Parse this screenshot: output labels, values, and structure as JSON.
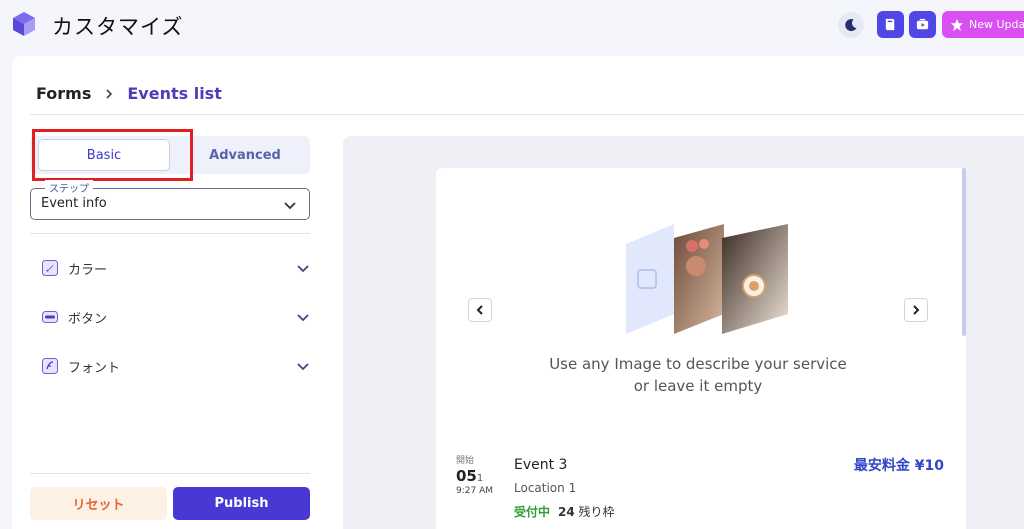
{
  "app": {
    "title": "カスタマイズ",
    "new_update_label": "New Update"
  },
  "breadcrumb": {
    "items": [
      "Forms",
      "Events list"
    ]
  },
  "tabs": {
    "basic": "Basic",
    "advanced": "Advanced"
  },
  "step_select": {
    "legend": "ステップ",
    "value": "Event info"
  },
  "accordion": [
    {
      "label": "カラー",
      "icon": "rocket-icon"
    },
    {
      "label": "ボタン",
      "icon": "button-icon"
    },
    {
      "label": "フォント",
      "icon": "font-icon"
    }
  ],
  "actions": {
    "reset": "リセット",
    "publish": "Publish"
  },
  "preview": {
    "hero_text_line1": "Use any Image to describe your service",
    "hero_text_line2": "or leave it empty",
    "event": {
      "start_label": "開始",
      "day": "05",
      "month": "1",
      "time": "9:27 AM",
      "title": "Event 3",
      "location": "Location 1",
      "status": "受付中",
      "seats": "24",
      "seats_suffix": "残り枠",
      "price": "最安料金 ¥10"
    }
  },
  "colors": {
    "accent": "#4838d4",
    "link": "#4b3fb8",
    "update": "#d94ff0",
    "reset_text": "#e0682c",
    "status_open": "#2e9d3a",
    "price": "#3146c8"
  }
}
